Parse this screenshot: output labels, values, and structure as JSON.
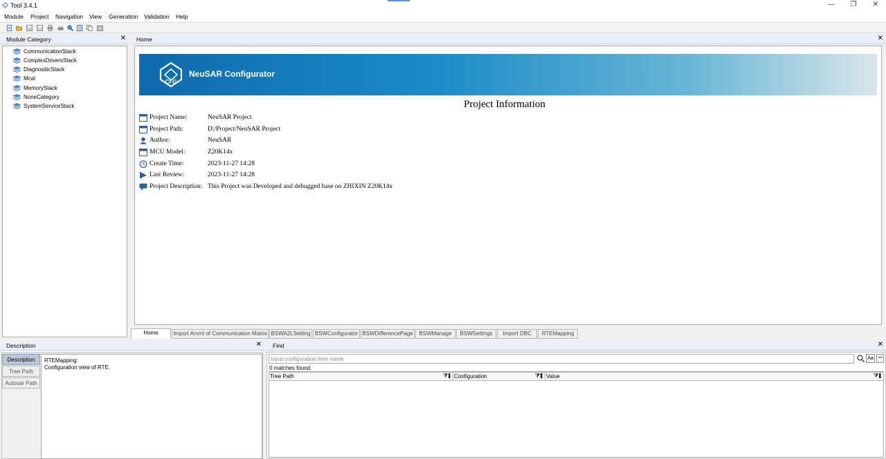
{
  "window": {
    "title": "Tool 3.4.1",
    "controls": {
      "minimize": "—",
      "restore": "❐",
      "close": "✕"
    }
  },
  "menu": [
    "Module",
    "Project",
    "Navigation",
    "View",
    "Generation",
    "Validation",
    "Help"
  ],
  "toolbar_icons": [
    "new-file-icon",
    "open-folder-icon",
    "save-icon",
    "save-all-icon",
    "print-icon",
    "print-preview-icon",
    "search-icon",
    "find-icon",
    "copy-icon",
    "paste-icon"
  ],
  "module_category": {
    "title": "Module Category",
    "close": "✕",
    "items": [
      "CommunicationStack",
      "ComplexDriversStack",
      "DiagnositicStack",
      "Mcal",
      "MemoryStack",
      "NoneCategory",
      "SystemServiceStack"
    ]
  },
  "home": {
    "title": "Home",
    "close": "✕",
    "banner": {
      "logo_text": "CFG",
      "brand": "NeuSAR Configurator"
    },
    "project_info_title": "Project Information",
    "fields": [
      {
        "icon": "window-icon",
        "label": "Project Name:",
        "value": "NeuSAR Project"
      },
      {
        "icon": "window-icon",
        "label": "Project Path:",
        "value": "D:/Project/NeuSAR Project"
      },
      {
        "icon": "user-icon",
        "label": "Author:",
        "value": "NeuSAR"
      },
      {
        "icon": "window-icon",
        "label": "MCU Model:",
        "value": "Z20K14x"
      },
      {
        "icon": "clock-icon",
        "label": "Create Time:",
        "value": "2023-11-27 14:28"
      },
      {
        "icon": "play-icon",
        "label": "Last Review:",
        "value": "2023-11-27 14:28"
      },
      {
        "icon": "comment-icon",
        "label": "Project Description:",
        "value": "This Project was Developed and debugged base on ZHIXIN Z20K14x"
      }
    ]
  },
  "tabs": [
    "Home",
    "Import Arxml of Communication Matrix",
    "BSWA2LSetting",
    "BSWConfigurator",
    "BSWDifferencePage",
    "BSWManage",
    "BSWSettings",
    "Import DBC",
    "RTEMapping"
  ],
  "active_tab": "Home",
  "description": {
    "title": "Description",
    "close": "✕",
    "side_tabs": [
      "Description",
      "Tree Path",
      "Autosar Path"
    ],
    "active_side_tab": "Description",
    "lines": [
      "RTEMapping:",
      "Configuration view of RTE."
    ]
  },
  "find": {
    "title": "Find",
    "close": "✕",
    "placeholder": "Input configuration item name",
    "value": "",
    "case_button": "Aa",
    "status": "0 matches found.",
    "columns": [
      "Tree Path",
      "Configuration",
      "Value"
    ]
  },
  "colors": {
    "accent": "#1a8cc7",
    "panel_header": "#eaf0f8",
    "active_side_tab": "#b8c6d8"
  }
}
